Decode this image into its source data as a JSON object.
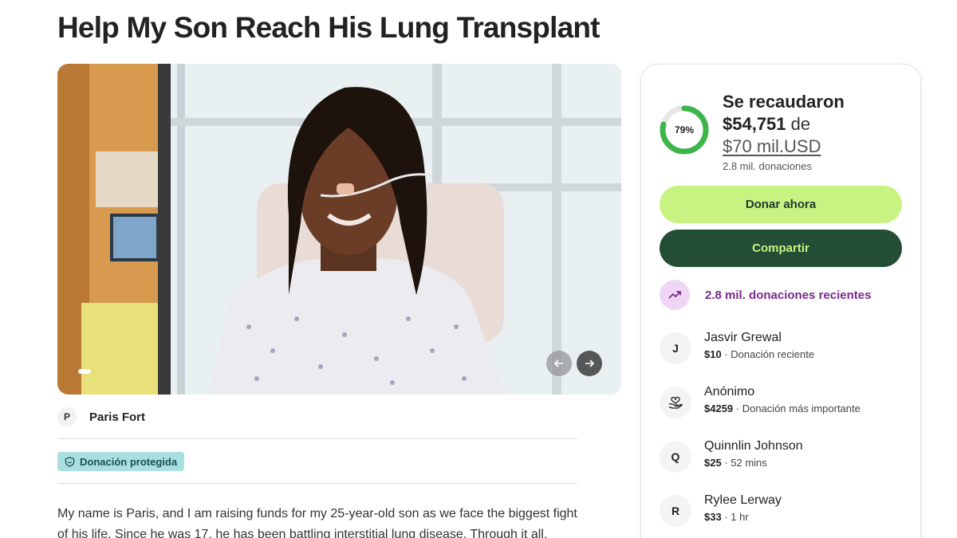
{
  "campaign": {
    "title": "Help My Son Reach His Lung Transplant",
    "organizer_initial": "P",
    "organizer_name": "Paris Fort",
    "badge_label": "Donación protegida",
    "story_text": "My name is Paris, and I am raising funds for my 25-year-old son as we face the biggest fight of his life. Since he was 17, he has been battling interstitial lung disease. Through it all,"
  },
  "carousel": {
    "prev_icon": "arrow-left-icon",
    "next_icon": "arrow-right-icon"
  },
  "sidebar": {
    "progress_percent_label": "79%",
    "progress_fraction": 0.79,
    "raised_label": "Se recaudaron",
    "raised_amount": "$54,751",
    "raised_connector": "de",
    "goal": "$70 mil.USD",
    "donation_count": "2.8 mil. donaciones",
    "donate_button": "Donar ahora",
    "share_button": "Compartir",
    "recent_label": "2.8 mil. donaciones recientes",
    "donors": [
      {
        "initial": "J",
        "name": "Jasvir Grewal",
        "amount": "$10",
        "detail": "· Donación reciente"
      },
      {
        "initial": "",
        "icon": "heart-hand-icon",
        "name": "Anónimo",
        "amount": "$4259",
        "detail": "· Donación más importante"
      },
      {
        "initial": "Q",
        "name": "Quinnlin Johnson",
        "amount": "$25",
        "detail": "· 52 mins"
      },
      {
        "initial": "R",
        "name": "Rylee Lerway",
        "amount": "$33",
        "detail": "· 1 hr"
      }
    ]
  },
  "colors": {
    "progress_green": "#3db54a",
    "donate_bg": "#c8f281",
    "share_bg": "#234d34",
    "recent_purple": "#7a2a8e",
    "badge_bg": "#a8dfe0"
  }
}
